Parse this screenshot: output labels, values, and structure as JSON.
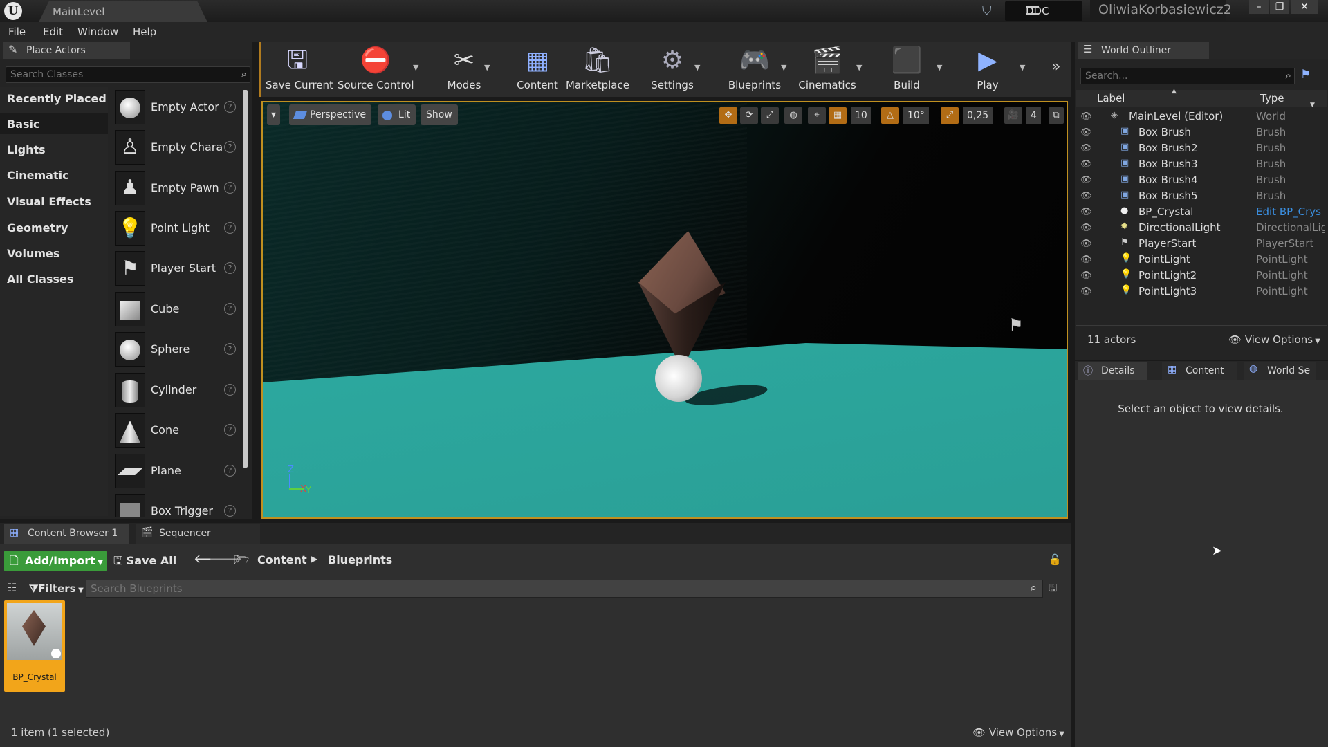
{
  "app": {
    "logo": "U",
    "level_tab": "MainLevel",
    "ddc": "DDC",
    "user": "OliwiaKorbasiewicz2"
  },
  "menu": [
    "File",
    "Edit",
    "Window",
    "Help"
  ],
  "place_actors": {
    "tab": "Place Actors",
    "search_placeholder": "Search Classes",
    "categories": [
      "Recently Placed",
      "Basic",
      "Lights",
      "Cinematic",
      "Visual Effects",
      "Geometry",
      "Volumes",
      "All Classes"
    ],
    "selected_category": "Basic",
    "items": [
      "Empty Actor",
      "Empty Chara",
      "Empty Pawn",
      "Point Light",
      "Player Start",
      "Cube",
      "Sphere",
      "Cylinder",
      "Cone",
      "Plane",
      "Box Trigger"
    ]
  },
  "toolbar": [
    "Save Current",
    "Source Control",
    "Modes",
    "Content",
    "Marketplace",
    "Settings",
    "Blueprints",
    "Cinematics",
    "Build",
    "Play"
  ],
  "viewport": {
    "perspective": "Perspective",
    "lit": "Lit",
    "show": "Show",
    "grid_snap": "10",
    "rot_snap": "10°",
    "scale_snap": "0,25",
    "cam_speed": "4",
    "axis_x": "X",
    "axis_y": "Y",
    "axis_z": "Z"
  },
  "outliner": {
    "tab": "World Outliner",
    "search_placeholder": "Search...",
    "col_label": "Label",
    "col_type": "Type",
    "rows": [
      {
        "label": "MainLevel (Editor)",
        "type": "World",
        "icon": "world-icon"
      },
      {
        "label": "Box Brush",
        "type": "Brush",
        "icon": "brush-icon"
      },
      {
        "label": "Box Brush2",
        "type": "Brush",
        "icon": "brush-icon"
      },
      {
        "label": "Box Brush3",
        "type": "Brush",
        "icon": "brush-icon"
      },
      {
        "label": "Box Brush4",
        "type": "Brush",
        "icon": "brush-icon"
      },
      {
        "label": "Box Brush5",
        "type": "Brush",
        "icon": "brush-icon"
      },
      {
        "label": "BP_Crystal",
        "type": "Edit BP_Crys",
        "icon": "blueprint-actor-icon"
      },
      {
        "label": "DirectionalLight",
        "type": "DirectionalLig",
        "icon": "directional-light-icon"
      },
      {
        "label": "PlayerStart",
        "type": "PlayerStart",
        "icon": "player-start-icon"
      },
      {
        "label": "PointLight",
        "type": "PointLight",
        "icon": "point-light-icon"
      },
      {
        "label": "PointLight2",
        "type": "PointLight",
        "icon": "point-light-icon"
      },
      {
        "label": "PointLight3",
        "type": "PointLight",
        "icon": "point-light-icon"
      }
    ],
    "count": "11 actors",
    "view_options": "View Options"
  },
  "details": {
    "tabs": [
      "Details",
      "Content",
      "World Se"
    ],
    "empty_msg": "Select an object to view details."
  },
  "content_browser": {
    "tabs": [
      "Content Browser 1",
      "Sequencer"
    ],
    "add_import": "Add/Import",
    "save_all": "Save All",
    "path": [
      "Content",
      "Blueprints"
    ],
    "filters": "Filters",
    "search_placeholder": "Search Blueprints",
    "asset": "BP_Crystal",
    "status": "1 item (1 selected)",
    "view_options": "View Options"
  },
  "colors": {
    "accent": "#f2a51a",
    "blue_link": "#3b8fe0",
    "floor": "#2aa79e"
  }
}
